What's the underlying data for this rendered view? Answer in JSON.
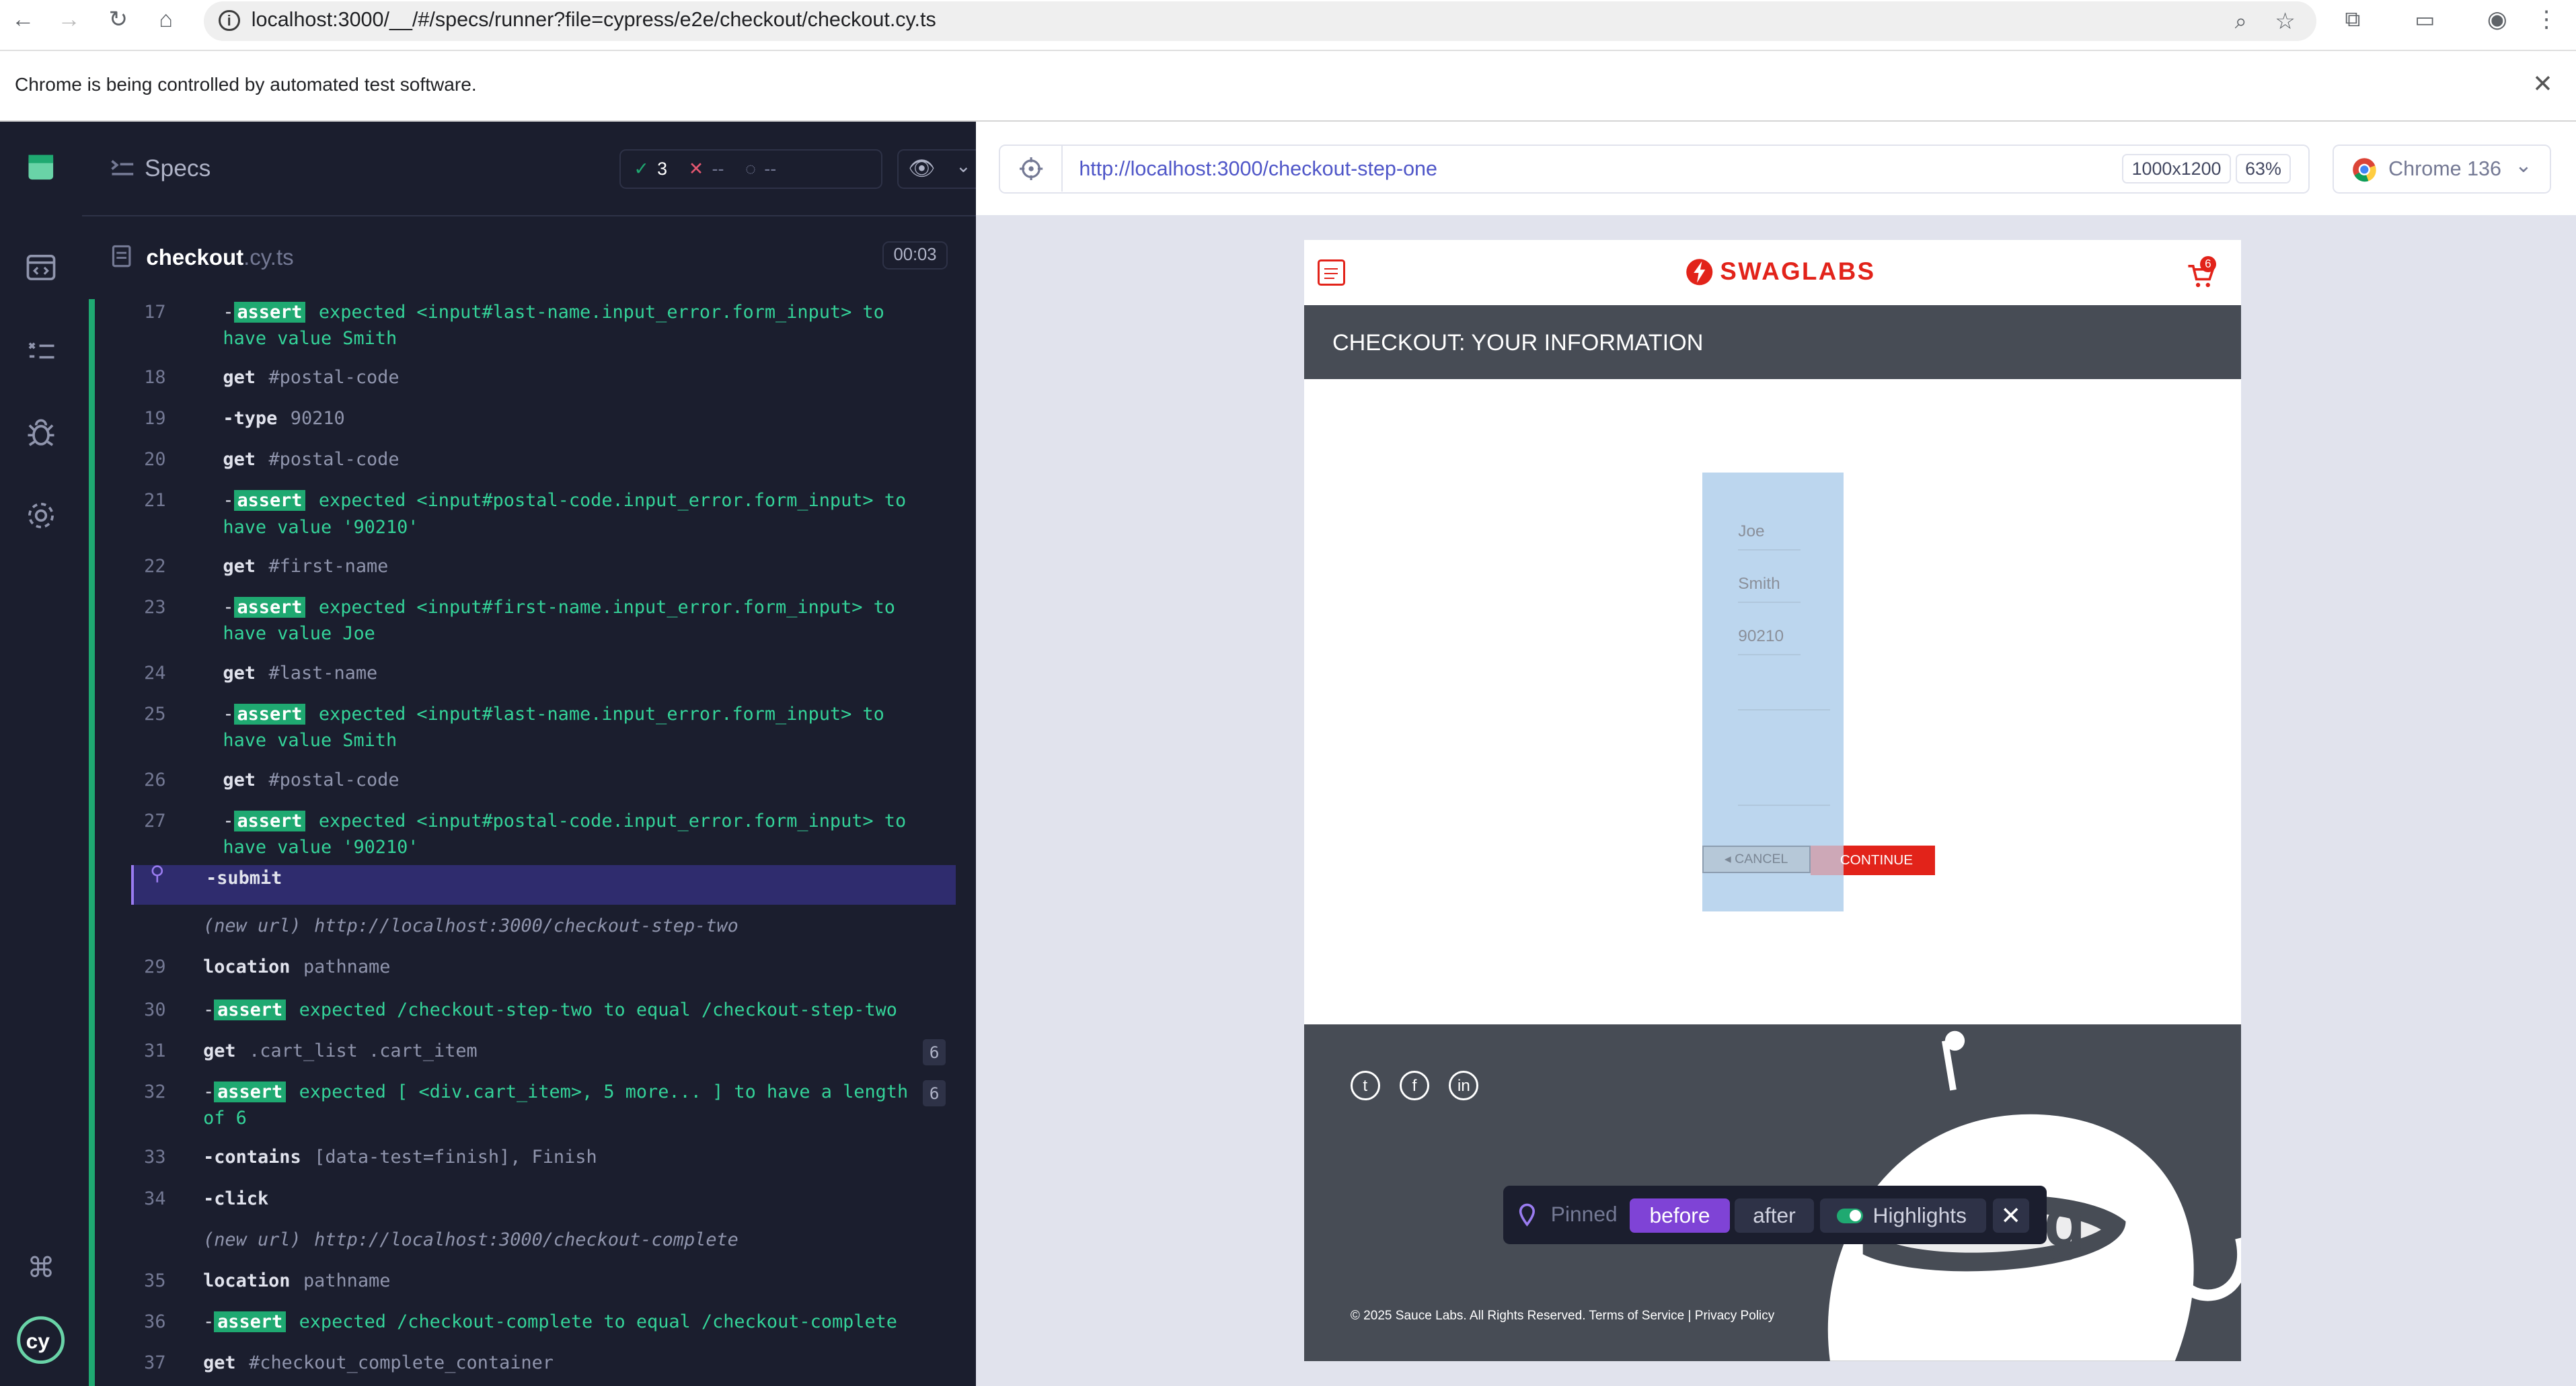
{
  "browser": {
    "url": "localhost:3000/__/#/specs/runner?file=cypress/e2e/checkout/checkout.cy.ts",
    "automation_notice": "Chrome is being controlled by automated test software."
  },
  "reporter": {
    "specs_label": "Specs",
    "passed": "3",
    "failed": "--",
    "pending": "--",
    "file_name": "checkout",
    "file_ext": ".cy.ts",
    "duration": "00:03",
    "commands": [
      {
        "num": "17",
        "name": "-assert",
        "text": "expected <input#last-name.input_error.form_input> to",
        "text2": "have value Smith"
      },
      {
        "num": "18",
        "name": "get",
        "text": "#postal-code"
      },
      {
        "num": "19",
        "name": "-type",
        "text": "90210"
      },
      {
        "num": "20",
        "name": "get",
        "text": "#postal-code"
      },
      {
        "num": "21",
        "name": "-assert",
        "text": "expected <input#postal-code.input_error.form_input> to",
        "text2": "have value '90210'"
      },
      {
        "num": "22",
        "name": "get",
        "text": "#first-name"
      },
      {
        "num": "23",
        "name": "-assert",
        "text": "expected <input#first-name.input_error.form_input> to",
        "text2": "have value Joe"
      },
      {
        "num": "24",
        "name": "get",
        "text": "#last-name"
      },
      {
        "num": "25",
        "name": "-assert",
        "text": "expected <input#last-name.input_error.form_input> to",
        "text2": "have value Smith"
      },
      {
        "num": "26",
        "name": "get",
        "text": "#postal-code"
      },
      {
        "num": "27",
        "name": "-assert",
        "text": "expected <input#postal-code.input_error.form_input> to",
        "text2": "have value '90210'"
      },
      {
        "num": "",
        "name": "-submit",
        "text": ""
      },
      {
        "num": "",
        "name": "(new url)",
        "text": "http://localhost:3000/checkout-step-two"
      },
      {
        "num": "29",
        "name": "location",
        "text": "pathname"
      },
      {
        "num": "30",
        "name": "-assert",
        "text": "expected /checkout-step-two to equal /checkout-step-two"
      },
      {
        "num": "31",
        "name": "get",
        "text": ".cart_list .cart_item",
        "count": "6"
      },
      {
        "num": "32",
        "name": "-assert",
        "text": "expected [ <div.cart_item>, 5 more... ] to have a length",
        "text2": "of 6",
        "count": "6"
      },
      {
        "num": "33",
        "name": "-contains",
        "text": "[data-test=finish], Finish"
      },
      {
        "num": "34",
        "name": "-click",
        "text": ""
      },
      {
        "num": "",
        "name": "(new url)",
        "text": "http://localhost:3000/checkout-complete"
      },
      {
        "num": "35",
        "name": "location",
        "text": "pathname"
      },
      {
        "num": "36",
        "name": "-assert",
        "text": "expected /checkout-complete to equal /checkout-complete"
      },
      {
        "num": "37",
        "name": "get",
        "text": "#checkout_complete_container"
      }
    ]
  },
  "aut": {
    "url": "http://localhost:3000/checkout-step-one",
    "viewport": "1000x1200",
    "scale": "63%",
    "browser_name": "Chrome 136",
    "logo_text": "SWAGLABS",
    "cart_count": "6",
    "section_title": "CHECKOUT: YOUR INFORMATION",
    "first_name": "Joe",
    "last_name": "Smith",
    "postal_code": "90210",
    "cancel_label": "◂ CANCEL",
    "continue_label": "CONTINUE",
    "copyright": "© 2025 Sauce Labs. All Rights Reserved. Terms of Service | Privacy Policy"
  },
  "pinbar": {
    "pinned_label": "Pinned",
    "before_label": "before",
    "after_label": "after",
    "highlights_label": "Highlights"
  },
  "colors": {
    "accent": "#7f43d6",
    "pass": "#1fa971",
    "brand": "#e2231a"
  }
}
